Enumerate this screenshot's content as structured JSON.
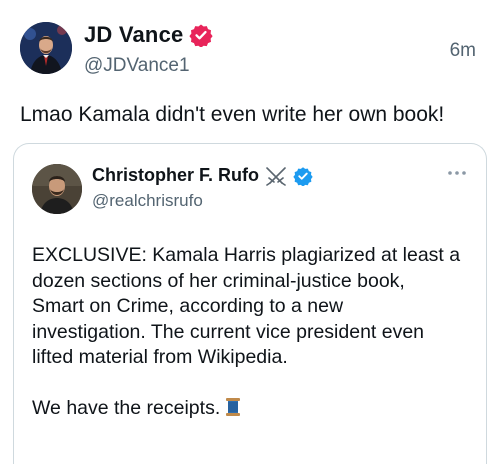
{
  "author": {
    "name": "JD Vance",
    "handle": "@JDVance1",
    "timestamp": "6m",
    "avatar_icon": "profile-photo",
    "verified_icon": "gold-verified-badge",
    "verified_color": "#e0245e"
  },
  "post": {
    "text": "Lmao Kamala didn't even write her own book!"
  },
  "quote": {
    "name": "Christopher F. Rufo",
    "name_emoji_icon": "crossed-swords-icon",
    "verified_icon": "blue-verified-badge",
    "verified_color": "#1d9bf0",
    "handle": "@realchrisrufo",
    "more_icon": "more-options-icon",
    "body_line1": "EXCLUSIVE: Kamala Harris plagiarized at least a",
    "body_line2": "dozen sections of her criminal-justice book,",
    "body_line3": "Smart on Crime, according to a new",
    "body_line4": "investigation. The current vice president even",
    "body_line5": "lifted material from Wikipedia.",
    "body_line6": "We have the receipts.",
    "trailing_emoji_icon": "spool-of-thread-icon"
  }
}
